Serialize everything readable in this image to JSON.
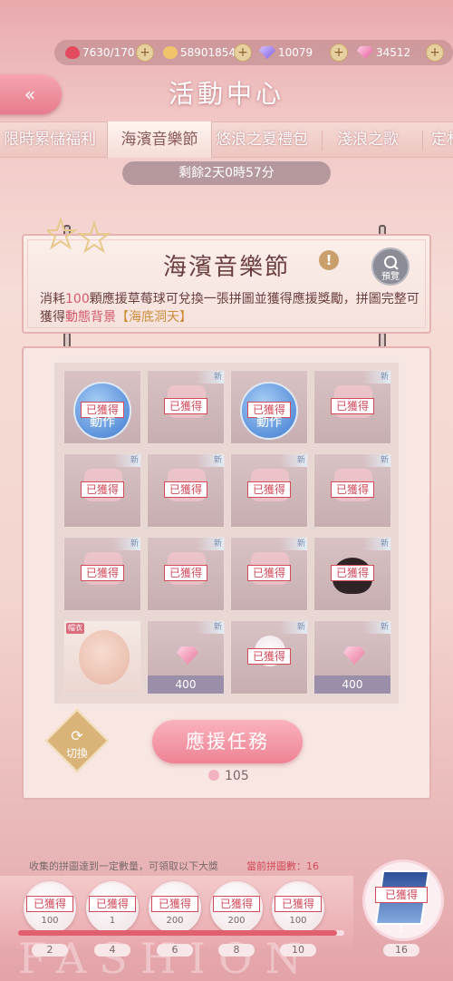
{
  "currency": {
    "stamina": "7630/170",
    "gold": "58901854",
    "diamond": "10079",
    "gem": "34512"
  },
  "header": {
    "title": "活動中心",
    "back_icon": "«"
  },
  "tabs": [
    "限時累儲福利",
    "海濱音樂節",
    "悠浪之夏禮包",
    "淺浪之歌",
    "定林"
  ],
  "timer": "剩餘2天0時57分",
  "event": {
    "title": "海濱音樂節",
    "preview_label": "預覽",
    "desc_1": "消耗",
    "desc_num": "100",
    "desc_2": "顆應援草莓球可兌換一張拼圖並獲得應援獎勵，拼圖完整可獲得",
    "desc_3": "動態背景",
    "desc_4": "【海底洞天】"
  },
  "cells": {
    "got": "已獲得",
    "new": "新",
    "action": "動作",
    "price": "400",
    "tag": "帽衣"
  },
  "switch_label": "切換",
  "mission_label": "應援任務",
  "count": "105",
  "rewards": {
    "note": "收集的拼圖達到一定數量，可領取以下大獎",
    "current": "當前拼圖數：16",
    "got": "已獲得",
    "qty": [
      "100",
      "1",
      "200",
      "200",
      "100"
    ],
    "milestones": [
      "2",
      "4",
      "6",
      "8",
      "10"
    ],
    "big_qty": "1",
    "big_milestone": "16"
  },
  "watermark": "FASHION",
  "colors": {
    "accent": "#e0606f",
    "button": "#ee8294",
    "got_border": "#d24a5a"
  }
}
